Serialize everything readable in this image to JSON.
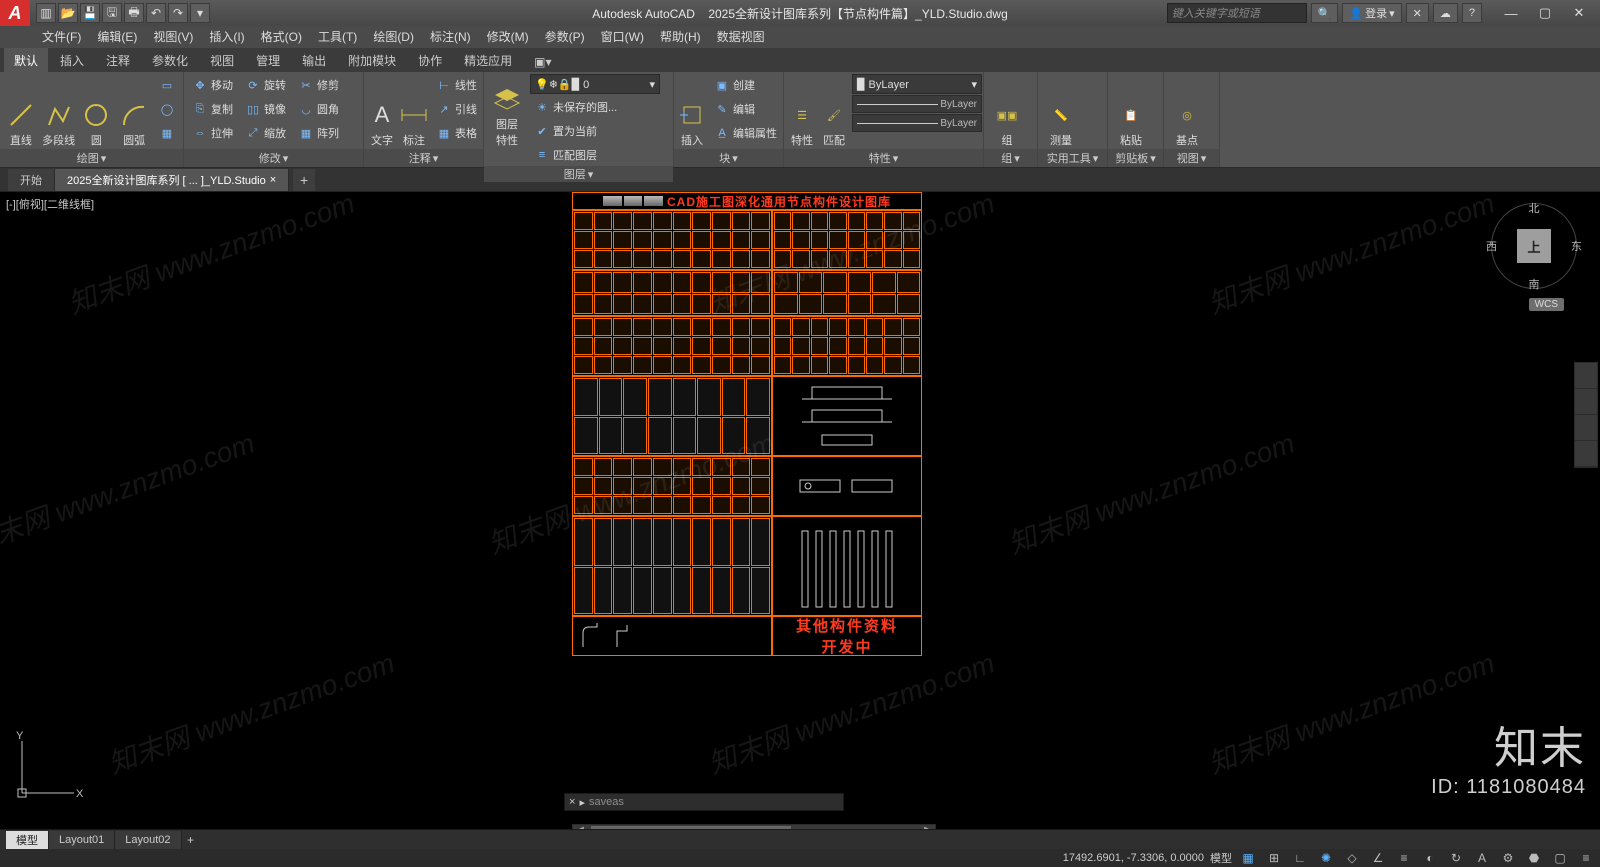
{
  "titlebar": {
    "app_name": "Autodesk AutoCAD",
    "doc_title": "2025全新设计图库系列【节点构件篇】_YLD.Studio.dwg",
    "search_placeholder": "键入关键字或短语",
    "login_label": "登录"
  },
  "menubar": {
    "items": [
      "文件(F)",
      "编辑(E)",
      "视图(V)",
      "插入(I)",
      "格式(O)",
      "工具(T)",
      "绘图(D)",
      "标注(N)",
      "修改(M)",
      "参数(P)",
      "窗口(W)",
      "帮助(H)",
      "数据视图"
    ]
  },
  "ribbon_tabs": [
    "默认",
    "插入",
    "注释",
    "参数化",
    "视图",
    "管理",
    "输出",
    "附加模块",
    "协作",
    "精选应用"
  ],
  "ribbon_active_tab": "默认",
  "ribbon_panels": {
    "draw": {
      "title": "绘图",
      "btns": {
        "line": "直线",
        "polyline": "多段线",
        "circle": "圆",
        "arc": "圆弧"
      }
    },
    "modify": {
      "title": "修改",
      "rows": {
        "move": "移动",
        "rotate": "旋转",
        "trim": "修剪",
        "copy": "复制",
        "mirror": "镜像",
        "fillet": "圆角",
        "stretch": "拉伸",
        "scale": "缩放",
        "array": "阵列"
      }
    },
    "annotation": {
      "title": "注释",
      "btns": {
        "text": "文字",
        "dim": "标注"
      },
      "rows": {
        "linear": "线性",
        "leader": "引线",
        "table": "表格"
      }
    },
    "layers": {
      "title": "图层",
      "btn": "图层\n特性"
    },
    "block": {
      "title": "块",
      "btns": {
        "insert": "插入"
      },
      "rows": {
        "create": "创建",
        "edit": "编辑",
        "attr": "编辑属性"
      }
    },
    "properties": {
      "title": "特性",
      "btn1": "特性",
      "btn2": "匹配",
      "bylayer": "ByLayer"
    },
    "group": {
      "title": "组",
      "btn": "组"
    },
    "utilities": {
      "title": "实用工具",
      "btn": "测量"
    },
    "clipboard": {
      "title": "剪贴板",
      "btn": "粘贴"
    },
    "view": {
      "title": "视图",
      "btn": "基点"
    },
    "layerrows": {
      "r1": "未保存的图...",
      "r2": "置为当前",
      "r3": "匹配图层"
    }
  },
  "file_tabs": {
    "start": "开始",
    "doc": "2025全新设计图库系列 [ ... ]_YLD.Studio"
  },
  "drawing": {
    "view_label": "[-][俯视][二维线框]",
    "viewcube": {
      "face": "上",
      "n": "北",
      "s": "南",
      "e": "东",
      "w": "西",
      "wcs": "WCS"
    },
    "title": "CAD施工图深化通用节点构件设计图库",
    "footer_l1": "其他构件资料",
    "footer_l2": "开发中",
    "ucs": {
      "x": "X",
      "y": "Y"
    }
  },
  "cmdline": {
    "hint": "saveas",
    "prefix": "× ▸"
  },
  "layout_tabs": [
    "模型",
    "Layout01",
    "Layout02"
  ],
  "status": {
    "coords": "17492.6901, -7.3306, 0.0000",
    "mode": "模型"
  },
  "watermark": {
    "text": "知末网 www.znzmo.com",
    "logo": "知末",
    "id": "ID: 1181080484"
  }
}
